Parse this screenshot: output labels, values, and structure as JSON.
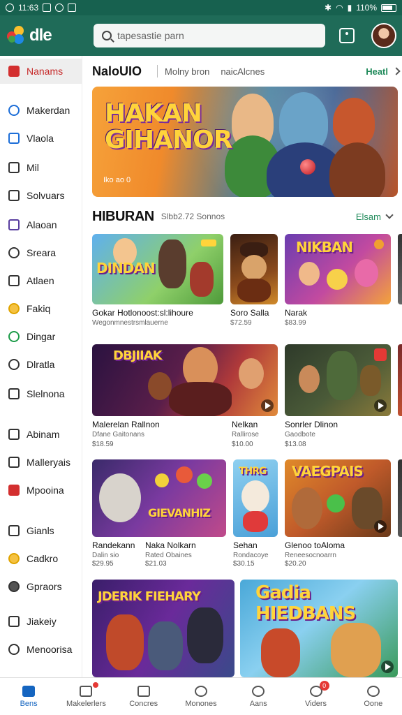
{
  "status_bar": {
    "time": "11:63",
    "battery": "110%"
  },
  "header": {
    "logo_text": "dle",
    "search_placeholder": "tapesastie parn",
    "icons": [
      "search-icon",
      "bookmark-icon",
      "avatar"
    ]
  },
  "sidebar": {
    "items": [
      {
        "label": "Nanams",
        "icon": "home-icon",
        "active": true
      },
      {
        "label": "Makerdan",
        "icon": "user-icon"
      },
      {
        "label": "Vlaola",
        "icon": "brush-icon"
      },
      {
        "label": "Mil",
        "icon": "house-icon"
      },
      {
        "label": "Solvuars",
        "icon": "list-icon"
      },
      {
        "label": "Alaoan",
        "icon": "gamepad-icon"
      },
      {
        "label": "Sreara",
        "icon": "chat-icon"
      },
      {
        "label": "Atlaen",
        "icon": "calendar-icon"
      },
      {
        "label": "Fakiq",
        "icon": "smile-icon"
      },
      {
        "label": "Dingar",
        "icon": "circle-icon"
      },
      {
        "label": "Dlratla",
        "icon": "play-icon"
      },
      {
        "label": "Slelnona",
        "icon": "close-box-icon"
      },
      {
        "label": "Abinam",
        "icon": "chart-icon"
      },
      {
        "label": "Malleryais",
        "icon": "square-icon"
      },
      {
        "label": "Mpooina",
        "icon": "youtube-icon"
      },
      {
        "label": "Gianls",
        "icon": "edit-icon"
      },
      {
        "label": "Cadkro",
        "icon": "emoji-icon"
      },
      {
        "label": "Gpraors",
        "icon": "disc-icon"
      },
      {
        "label": "Jiakeiy",
        "icon": "window-icon"
      },
      {
        "label": "Menoorisa",
        "icon": "ring-icon"
      }
    ]
  },
  "topnav": {
    "title": "NaloUIO",
    "tabs": [
      "Molny bron",
      "naicAlcnes"
    ],
    "link": "Heatl"
  },
  "hero": {
    "title": "HAKAN GIHANOR",
    "caption": "Iko ao 0"
  },
  "section": {
    "title": "HIBURAN",
    "subtitle": "Slbb2.72 Sonnos",
    "link": "Elsam"
  },
  "cards": [
    {
      "title": "Gokar Hotlonoost:sl:lihoure",
      "sub": "Wegonmnestrsmlauerne",
      "price": "",
      "thumb_text": "DINDAN"
    },
    {
      "title": "Soro Salla",
      "sub": "$72.59",
      "price": "",
      "thumb_text": ""
    },
    {
      "title": "Narak",
      "sub": "$83.99",
      "price": "",
      "thumb_text": "NIKBAN"
    },
    {
      "title": "Malerelan Rallnon",
      "sub": "Dfane Gaitonans",
      "price": "$18.59",
      "thumb_text": "DBJIIAK"
    },
    {
      "title": "Nelkan",
      "sub": "Rallirose",
      "price": "$10.00",
      "thumb_text": ""
    },
    {
      "title": "Sonrler Dlinon",
      "sub": "Gaodbote",
      "price": "$13.08",
      "thumb_text": ""
    },
    {
      "title": "Randekann",
      "sub": "Dalin sio",
      "price": "$29.95",
      "thumb_text": "GIEVANHIZ"
    },
    {
      "title": "Naka Nolkarn",
      "sub": "Rated Obaines",
      "price": "$21.03",
      "thumb_text": ""
    },
    {
      "title": "Sehan",
      "sub": "Rondacoye",
      "price": "$30.15",
      "thumb_text": "THRG"
    },
    {
      "title": "Glenoo toAloma",
      "sub": "Reneesocnoarrn",
      "price": "$20.20",
      "thumb_text": "VAEGPAIS"
    },
    {
      "title": "",
      "sub": "",
      "price": "",
      "thumb_text": "JDERIK FIEHARY"
    },
    {
      "title": "",
      "sub": "",
      "price": "",
      "thumb_text": "Gadia HIEDBANS"
    }
  ],
  "bottom_nav": [
    {
      "label": "Bens",
      "icon": "home-icon",
      "active": true
    },
    {
      "label": "Makelerlers",
      "icon": "bell-icon",
      "dot": true
    },
    {
      "label": "Concres",
      "icon": "box-icon"
    },
    {
      "label": "Monones",
      "icon": "clock-icon"
    },
    {
      "label": "Aans",
      "icon": "heart-icon"
    },
    {
      "label": "Viders",
      "icon": "chat-icon",
      "count": "0"
    },
    {
      "label": "Oone",
      "icon": "person-icon"
    }
  ],
  "colors": {
    "header": "#1f6b58",
    "status": "#17614f",
    "accent_red": "#c62828",
    "accent_green": "#1f8a5a",
    "active_blue": "#1565c0"
  }
}
